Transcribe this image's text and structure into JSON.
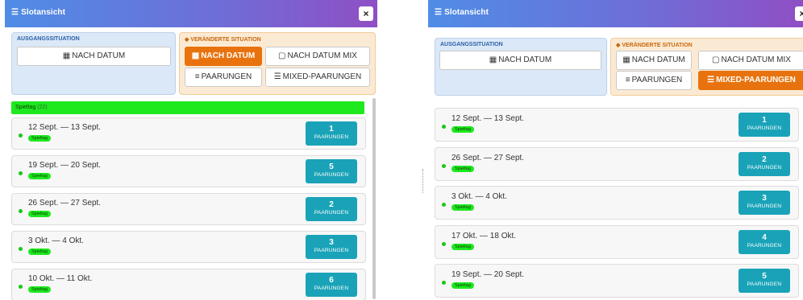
{
  "left": {
    "title": "Slotansicht",
    "close": "×",
    "ausgang_label": "AUSGANGSSITUATION",
    "ausgang_btn": "NACH DATUM",
    "veraendert_label": "VERÄNDERTE SITUATION",
    "tabs": [
      "NACH DATUM",
      "NACH DATUM MIX",
      "PAARUNGEN",
      "MIXED-PAARUNGEN"
    ],
    "active_tab": "NACH DATUM",
    "group_label": "Spieltag",
    "group_count": "(22)",
    "rows": [
      {
        "date": "12 Sept. — 13 Sept.",
        "tag": "Spieltag",
        "n": "1",
        "unit": "PAARUNGEN"
      },
      {
        "date": "19 Sept. — 20 Sept.",
        "tag": "Spieltag",
        "n": "5",
        "unit": "PAARUNGEN"
      },
      {
        "date": "26 Sept. — 27 Sept.",
        "tag": "Spieltag",
        "n": "2",
        "unit": "PAARUNGEN"
      },
      {
        "date": "3 Okt. — 4 Okt.",
        "tag": "Spieltag",
        "n": "3",
        "unit": "PAARUNGEN"
      },
      {
        "date": "10 Okt. — 11 Okt.",
        "tag": "Spieltag",
        "n": "6",
        "unit": "PAARUNGEN"
      }
    ]
  },
  "right": {
    "title": "Slotansicht",
    "close": "×",
    "ausgang_label": "AUSGANGSSITUATION",
    "ausgang_btn": "NACH DATUM",
    "veraendert_label": "VERÄNDERTE SITUATION",
    "tabs": [
      "NACH DATUM",
      "NACH DATUM MIX",
      "PAARUNGEN",
      "MIXED-PAARUNGEN"
    ],
    "active_tab": "MIXED-PAARUNGEN",
    "rows": [
      {
        "date": "12 Sept. — 13 Sept.",
        "tag": "Spieltag",
        "n": "1",
        "unit": "PAARUNGEN"
      },
      {
        "date": "26 Sept. — 27 Sept.",
        "tag": "Spieltag",
        "n": "2",
        "unit": "PAARUNGEN"
      },
      {
        "date": "3 Okt. — 4 Okt.",
        "tag": "Spieltag",
        "n": "3",
        "unit": "PAARUNGEN"
      },
      {
        "date": "17 Okt. — 18 Okt.",
        "tag": "Spieltag",
        "n": "4",
        "unit": "PAARUNGEN"
      },
      {
        "date": "19 Sept. — 20 Sept.",
        "tag": "Spieltag",
        "n": "5",
        "unit": "PAARUNGEN"
      }
    ]
  },
  "colors": {
    "active": "#e8730e",
    "count_btn": "#1aa3b8",
    "tag": "#1ee81e"
  }
}
